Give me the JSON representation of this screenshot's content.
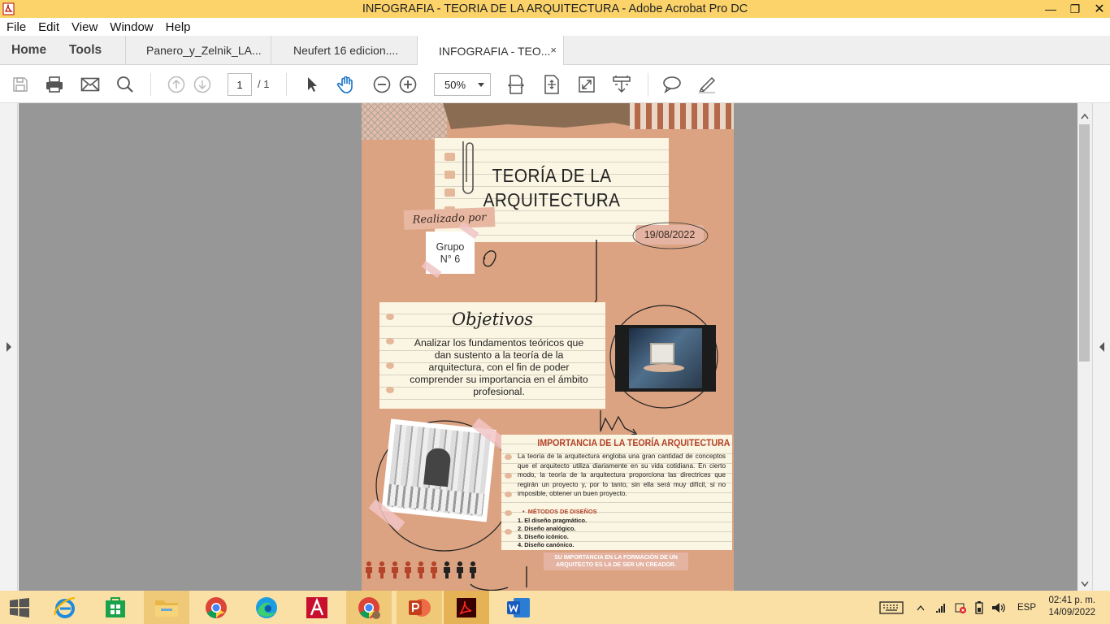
{
  "window": {
    "title": "INFOGRAFIA - TEORIA DE LA ARQUITECTURA - Adobe Acrobat Pro DC"
  },
  "menu": [
    "File",
    "Edit",
    "View",
    "Window",
    "Help"
  ],
  "tabs": {
    "home": "Home",
    "tools": "Tools",
    "docs": [
      "Panero_y_Zelnik_LA...",
      "Neufert 16 edicion....",
      "INFOGRAFIA - TEO..."
    ],
    "close_glyph": "×"
  },
  "toolbar": {
    "page_current": "1",
    "page_total": "/ 1",
    "zoom": "50%"
  },
  "document": {
    "title_line1": "TEORÍA DE LA",
    "title_line2": "ARQUITECTURA",
    "made_by": "Realizado por",
    "group_line1": "Grupo",
    "group_line2": "N° 6",
    "date": "19/08/2022",
    "objectives_heading": "Objetivos",
    "objectives_text": "Analizar los fundamentos teóricos que dan sustento a la teoría de la arquitectura, con el fin de poder comprender su importancia en el ámbito profesional.",
    "importance_heading": "IMPORTANCIA DE LA TEORÍA ARQUITECTURA",
    "importance_text": "La teoría de la arquitectura engloba una gran cantidad de conceptos que el arquitecto utiliza diariamente en su vida cotidiana. En cierto modo, la teoría de la arquitectura proporciona las directrices que regirán un proyecto y, por lo tanto, sin ella será muy difícil, si no imposible, obtener un buen proyecto.",
    "methods_heading": "MÉTODOS DE DISEÑOS",
    "methods": [
      "1. El diseño pragmático.",
      "2. Diseño analógico.",
      "3. Diseño icónico.",
      "4. Diseño canónico."
    ],
    "footer_note_line1": "SU IMPORTANCIA EN LA FORMACIÓN DE UN",
    "footer_note_line2": "ARQUITECTO ES LA DE SER UN CREADOR."
  },
  "taskbar": {
    "language": "ESP",
    "time": "02:41 p. m.",
    "date": "14/09/2022"
  },
  "colors": {
    "titlebar": "#fbd36a",
    "taskbar": "#fae0a5",
    "kraft": "#dca584",
    "accent_red": "#b5432a"
  }
}
